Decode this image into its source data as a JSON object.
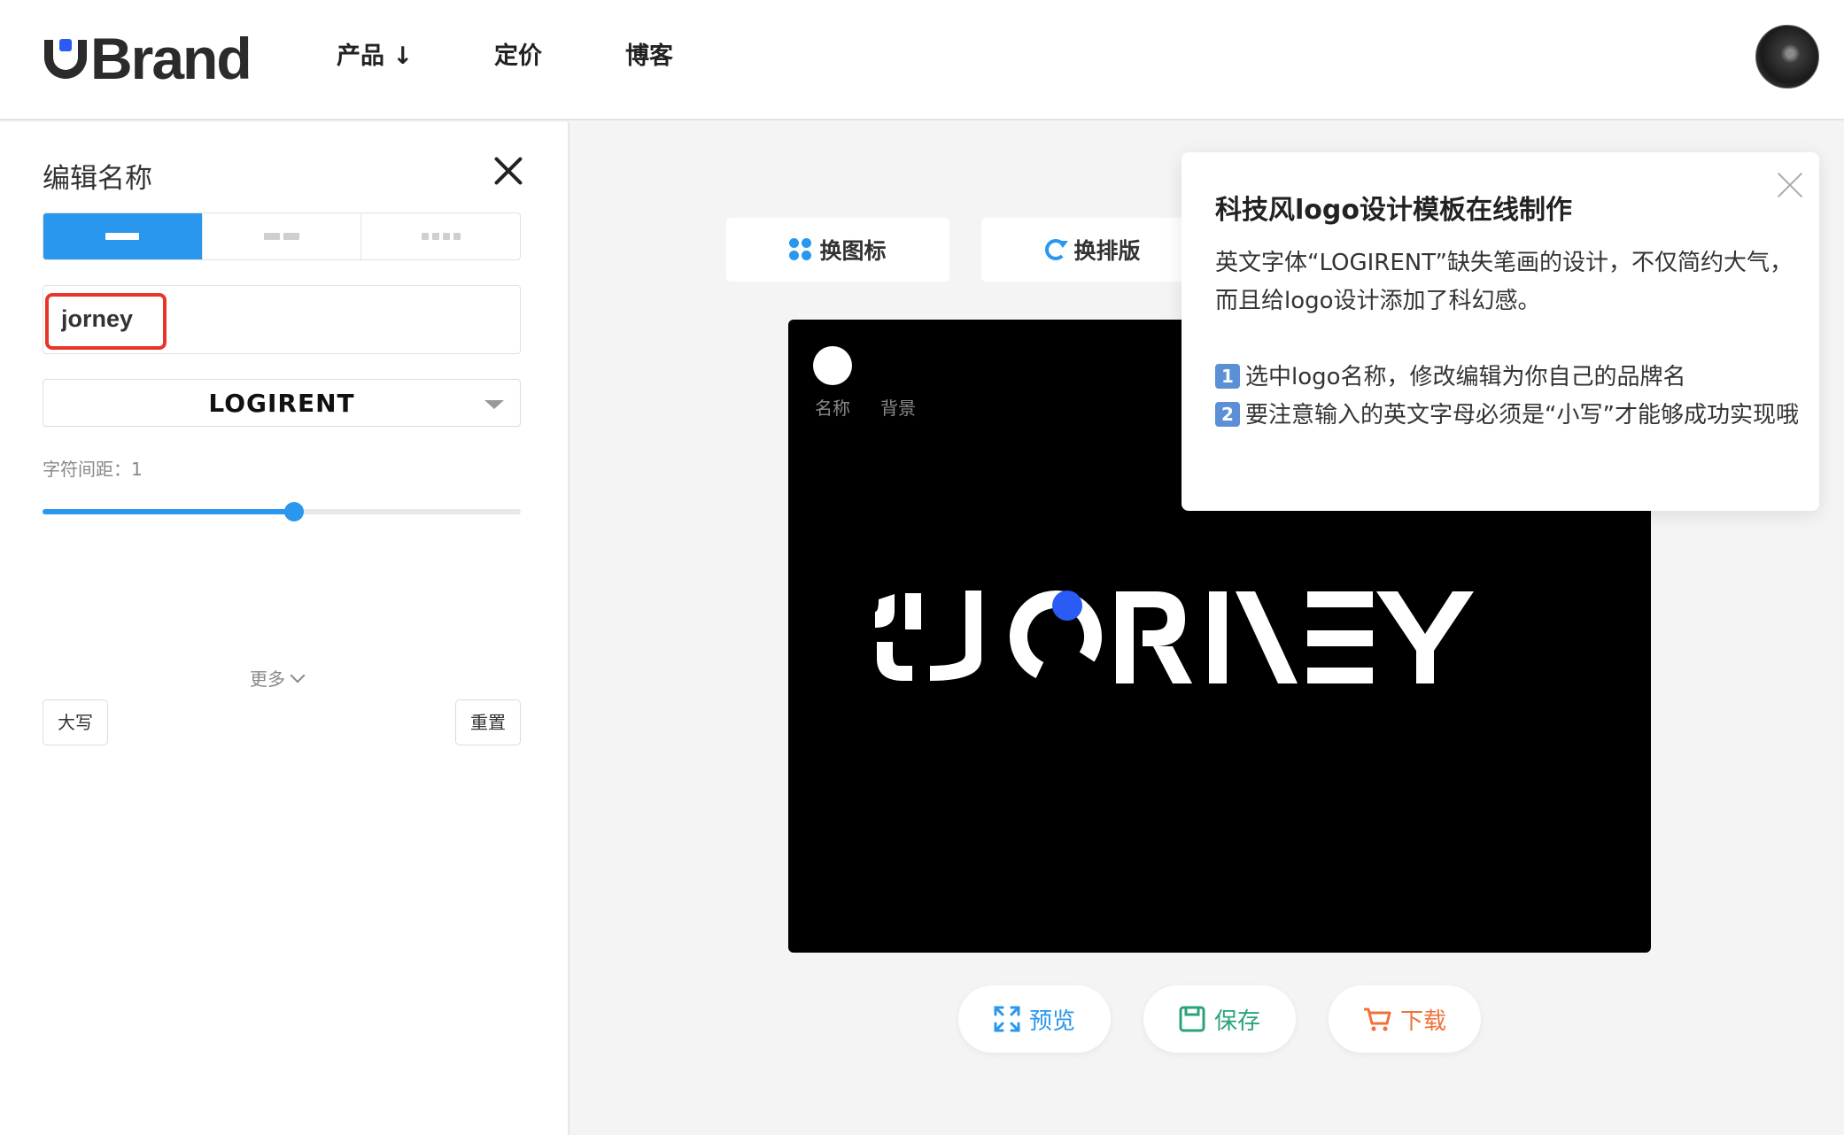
{
  "header": {
    "brand_text": "Brand",
    "nav": [
      {
        "label": "产品 ↓"
      },
      {
        "label": "定价"
      },
      {
        "label": "博客"
      }
    ]
  },
  "left_panel": {
    "title": "编辑名称",
    "name_value": "jorney",
    "font_name": "LOGIRENT",
    "spacing_label": "字符间距：1",
    "spacing_level": 0.525,
    "more_label": "更多",
    "uppercase_button": "大写",
    "reset_button": "重置"
  },
  "toolbar": {
    "change_icon": "换图标",
    "change_layout": "换排版"
  },
  "canvas": {
    "label_name": "名称",
    "label_background": "背景",
    "logo_text": "JORNEY",
    "background_color": "#000000",
    "text_color": "#ffffff",
    "accent_color": "#2a5bf5"
  },
  "actions": {
    "preview": "预览",
    "save": "保存",
    "download": "下载"
  },
  "tooltip": {
    "title": "科技风logo设计模板在线制作",
    "description": "英文字体“LOGIRENT”缺失笔画的设计，不仅简约大气，而且给logo设计添加了科幻感。",
    "step1_num": "1",
    "step1": "选中logo名称，修改编辑为你自己的品牌名",
    "step2_num": "2",
    "step2": "要注意输入的英文字母必须是“小写”才能够成功实现哦"
  },
  "colors": {
    "primary_blue": "#2a97ef",
    "save_green": "#2aa37a",
    "download_orange": "#f0713a",
    "highlight_red": "#e8352b"
  }
}
